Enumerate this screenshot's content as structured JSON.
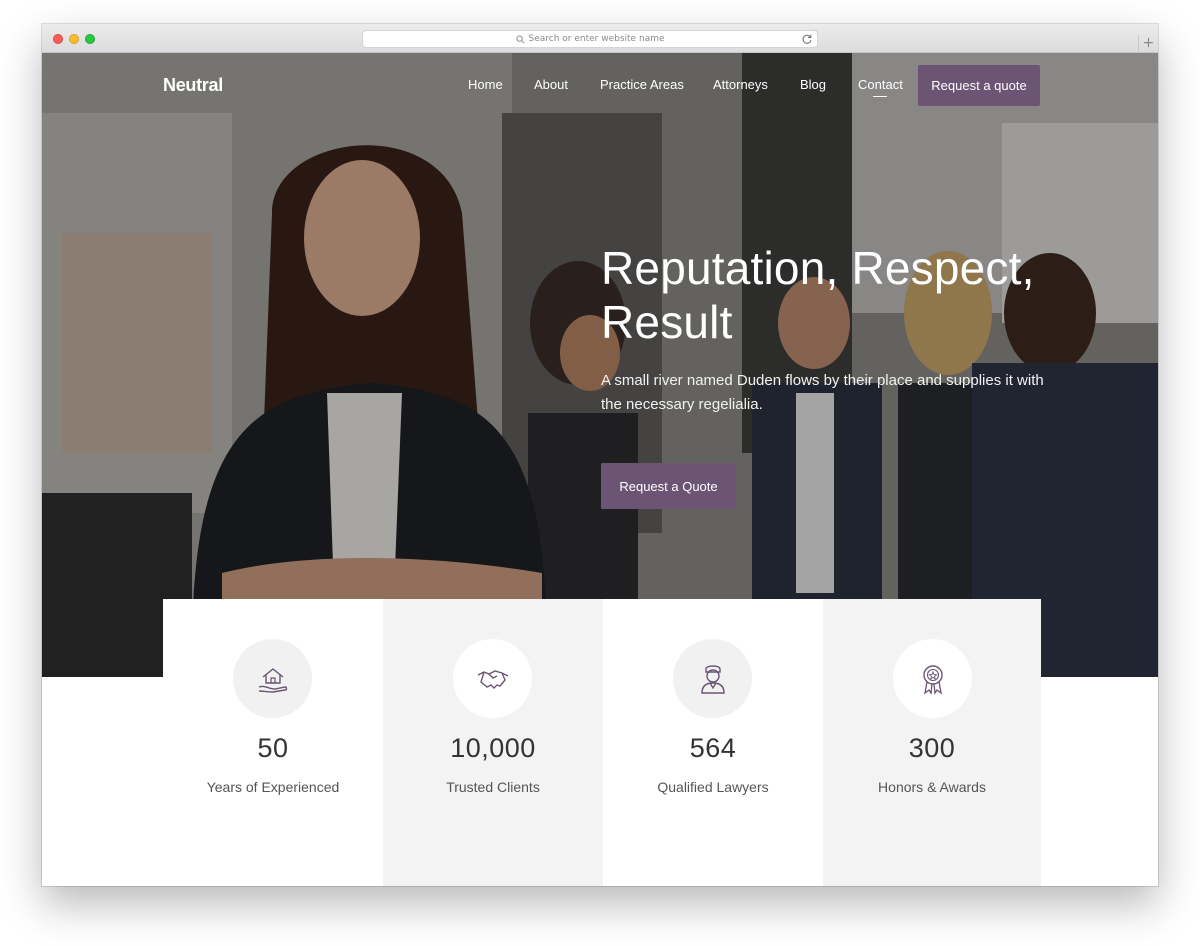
{
  "browser": {
    "address_placeholder": "Search or enter website name",
    "new_tab_symbol": "+"
  },
  "site": {
    "logo": "Neutral",
    "accent_color": "#6c5474",
    "nav": {
      "items": [
        {
          "label": "Home"
        },
        {
          "label": "About"
        },
        {
          "label": "Practice Areas"
        },
        {
          "label": "Attorneys"
        },
        {
          "label": "Blog"
        },
        {
          "label": "Contact"
        }
      ],
      "active": "Contact",
      "cta_label": "Request a quote"
    },
    "hero": {
      "title_line1": "Reputation, Respect,",
      "title_line2": "Result",
      "subtitle": "A small river named Duden flows by their place and supplies it with the necessary regelialia.",
      "button_label": "Request a Quote"
    },
    "stats": [
      {
        "icon": "house-in-hand-icon",
        "value": "50",
        "label": "Years of Experienced"
      },
      {
        "icon": "handshake-icon",
        "value": "10,000",
        "label": "Trusted Clients"
      },
      {
        "icon": "lawyer-icon",
        "value": "564",
        "label": "Qualified Lawyers"
      },
      {
        "icon": "award-medal-icon",
        "value": "300",
        "label": "Honors & Awards"
      }
    ]
  }
}
